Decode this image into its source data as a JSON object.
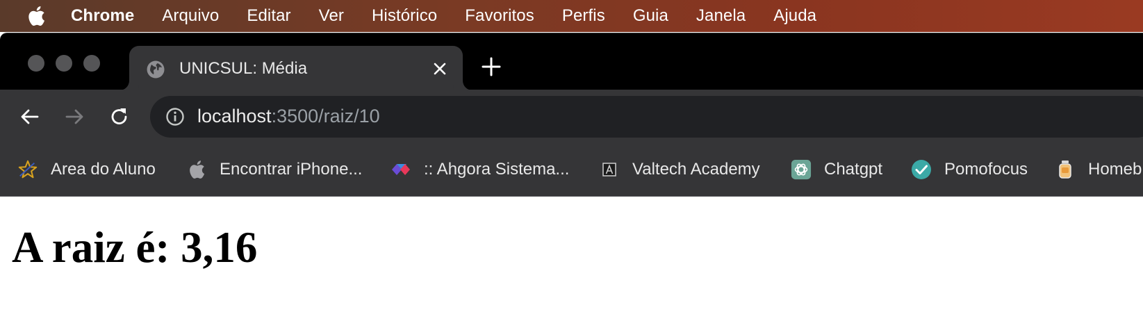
{
  "menubar": {
    "app": "Chrome",
    "items": [
      "Arquivo",
      "Editar",
      "Ver",
      "Histórico",
      "Favoritos",
      "Perfis",
      "Guia",
      "Janela",
      "Ajuda"
    ]
  },
  "tab": {
    "title": "UNICSUL: Média"
  },
  "omnibox": {
    "host": "localhost",
    "rest": ":3500/raiz/10"
  },
  "bookmarks": [
    {
      "label": "Area do Aluno",
      "icon": "star-icon"
    },
    {
      "label": "Encontrar iPhone...",
      "icon": "apple-icon"
    },
    {
      "label": ":: Ahgora Sistema...",
      "icon": "ahgora-icon"
    },
    {
      "label": "Valtech Academy",
      "icon": "valtech-icon"
    },
    {
      "label": "Chatgpt",
      "icon": "chatgpt-icon"
    },
    {
      "label": "Pomofocus",
      "icon": "check-circle-icon"
    },
    {
      "label": "Homeb",
      "icon": "jar-icon"
    }
  ],
  "page": {
    "heading": "A raiz é: 3,16"
  },
  "colors": {
    "tab_bg": "#353537",
    "omnibox_bg": "#202124",
    "pomofocus": "#3ba9a6",
    "chatgpt": "#6ba596"
  }
}
